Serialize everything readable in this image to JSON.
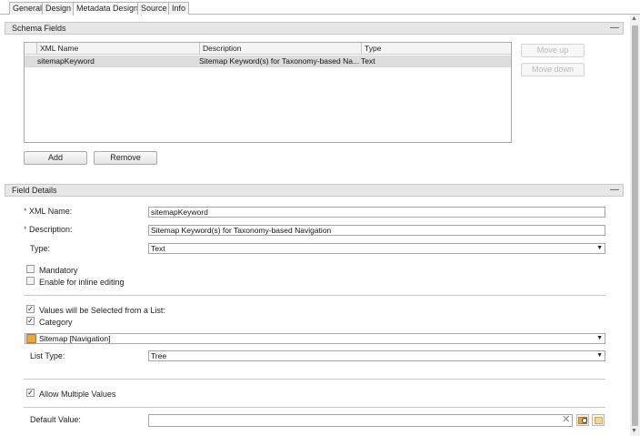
{
  "tabs": [
    "General",
    "Design",
    "Metadata Design",
    "Source",
    "Info"
  ],
  "schema_fields": {
    "title": "Schema Fields",
    "columns": [
      "XML Name",
      "Description",
      "Type"
    ],
    "rows": [
      {
        "xml_name": "sitemapKeyword",
        "description": "Sitemap Keyword(s) for Taxonomy-based Na...",
        "type": "Text"
      }
    ],
    "move_up": "Move up",
    "move_down": "Move down",
    "add": "Add",
    "remove": "Remove"
  },
  "field_details": {
    "title": "Field Details",
    "xml_name_label": "XML Name:",
    "xml_name_value": "sitemapKeyword",
    "description_label": "Description:",
    "description_value": "Sitemap Keyword(s) for Taxonomy-based Navigation",
    "type_label": "Type:",
    "type_value": "Text",
    "mandatory_label": "Mandatory",
    "mandatory_checked": false,
    "inline_label": "Enable for inline editing",
    "inline_checked": false,
    "list_label": "Values will be Selected from a List:",
    "list_checked": true,
    "category_label": "Category",
    "category_checked": true,
    "category_value": "Sitemap [Navigation]",
    "list_type_label": "List Type:",
    "list_type_value": "Tree",
    "multiple_label": "Allow Multiple Values",
    "multiple_checked": true,
    "default_label": "Default Value:",
    "default_value": ""
  },
  "icons": {
    "collapse": "minus-icon",
    "category": "category-folder-icon",
    "clear": "clear-x-icon",
    "browse": "browse-keyword-icon",
    "add_keyword": "add-keyword-icon"
  }
}
